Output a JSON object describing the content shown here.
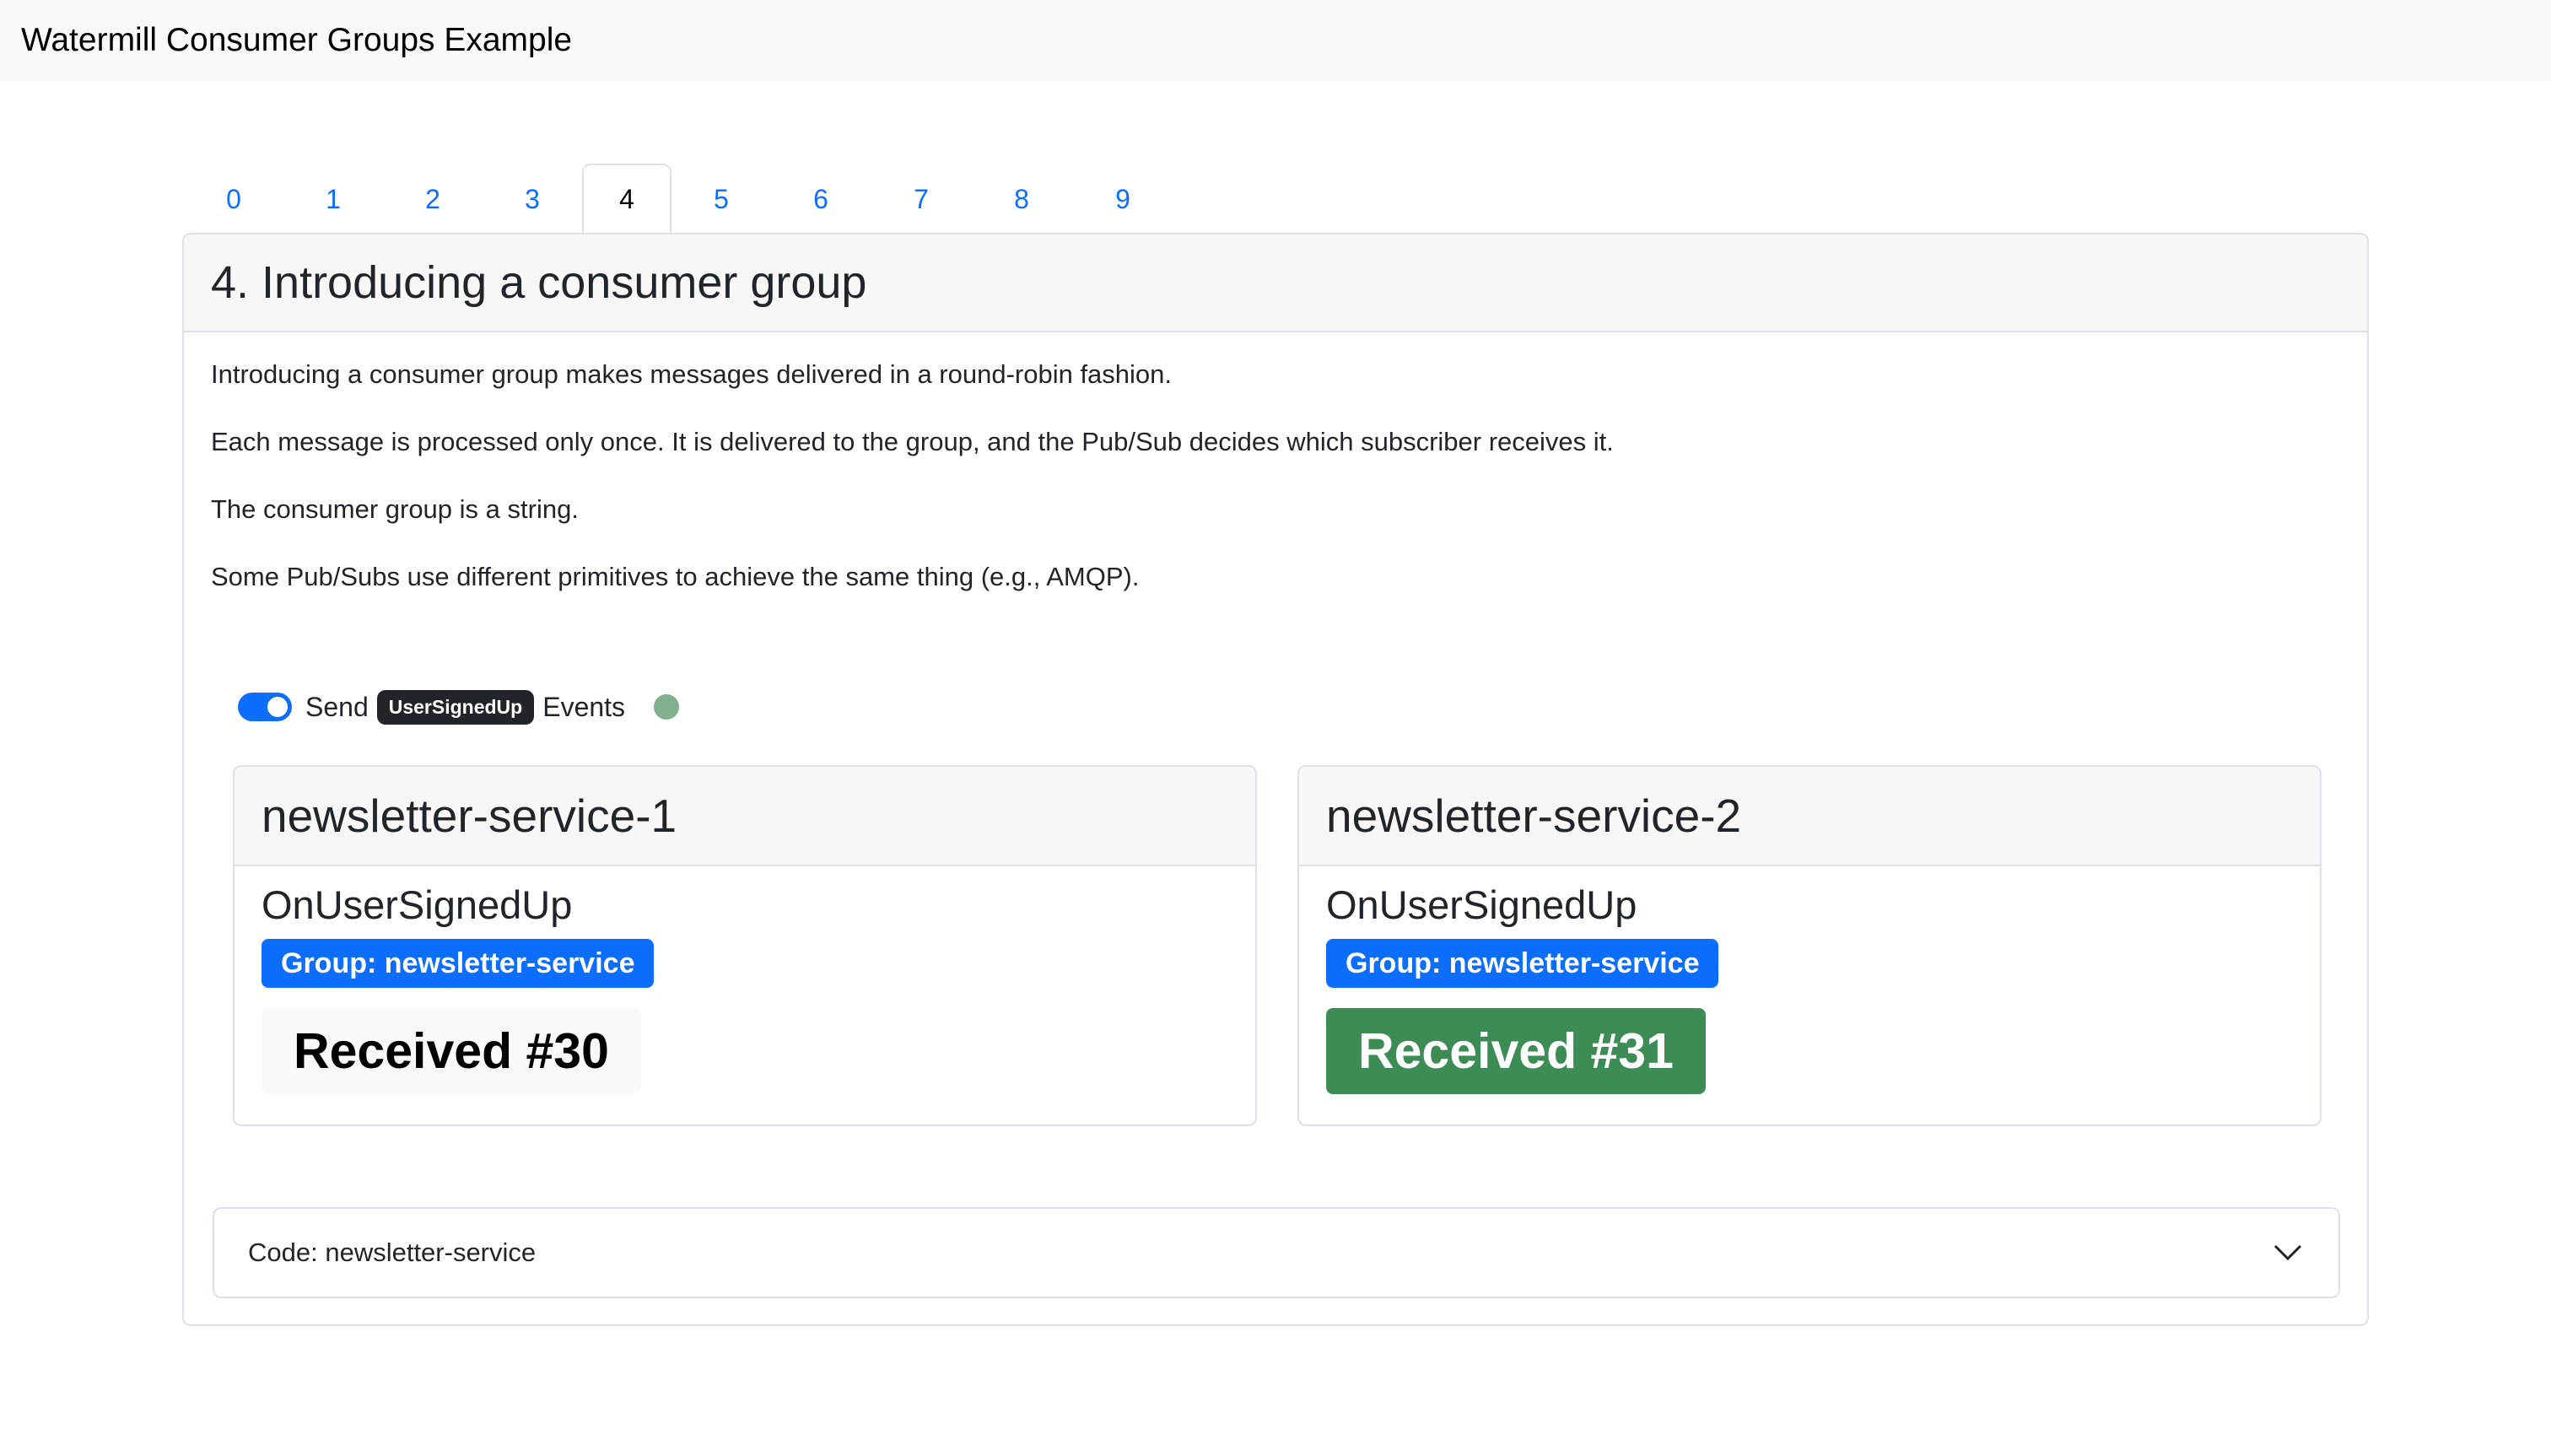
{
  "app": {
    "title": "Watermill Consumer Groups Example"
  },
  "tabs": [
    {
      "label": "0",
      "active": false
    },
    {
      "label": "1",
      "active": false
    },
    {
      "label": "2",
      "active": false
    },
    {
      "label": "3",
      "active": false
    },
    {
      "label": "4",
      "active": true
    },
    {
      "label": "5",
      "active": false
    },
    {
      "label": "6",
      "active": false
    },
    {
      "label": "7",
      "active": false
    },
    {
      "label": "8",
      "active": false
    },
    {
      "label": "9",
      "active": false
    }
  ],
  "step": {
    "title": "4. Introducing a consumer group",
    "paragraphs": [
      "Introducing a consumer group makes messages delivered in a round-robin fashion.",
      "Each message is processed only once. It is delivered to the group, and the Pub/Sub decides which subscriber receives it.",
      "The consumer group is a string.",
      "Some Pub/Subs use different primitives to achieve the same thing (e.g., AMQP)."
    ]
  },
  "send_control": {
    "toggle_on": true,
    "prefix": "Send",
    "event_name": "UserSignedUp",
    "suffix": "Events",
    "status_color": "#80b08e"
  },
  "services": [
    {
      "name": "newsletter-service-1",
      "handler": "OnUserSignedUp",
      "group": "Group: newsletter-service",
      "received": "Received #30",
      "highlighted": false
    },
    {
      "name": "newsletter-service-2",
      "handler": "OnUserSignedUp",
      "group": "Group: newsletter-service",
      "received": "Received #31",
      "highlighted": true
    }
  ],
  "code_section": {
    "label": "Code: newsletter-service",
    "expanded": false
  },
  "colors": {
    "accent": "#0d6efd",
    "received_active": "#3d8b55",
    "badge_dark": "#212529"
  }
}
